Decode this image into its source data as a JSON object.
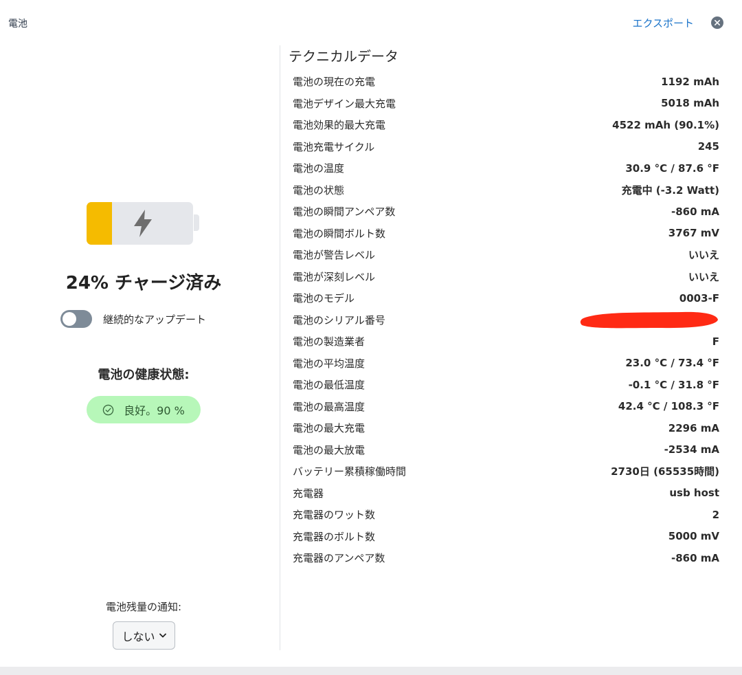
{
  "window": {
    "title": "電池"
  },
  "header": {
    "export_label": "エクスポート"
  },
  "battery": {
    "charge_percent": 24,
    "charge_text": "24% チャージ済み",
    "fill_color": "#f5bb00"
  },
  "continuous_update": {
    "label": "継続的なアップデート",
    "enabled": false
  },
  "health": {
    "title": "電池の健康状態:",
    "badge_text": "良好。90 %"
  },
  "notification": {
    "label": "電池残量の通知:",
    "selected": "しない"
  },
  "technical": {
    "title": "テクニカルデータ",
    "rows": [
      {
        "label": "電池の現在の充電",
        "value": "1192 mAh"
      },
      {
        "label": "電池デザイン最大充電",
        "value": "5018 mAh"
      },
      {
        "label": "電池効果的最大充電",
        "value": "4522 mAh (90.1%)"
      },
      {
        "label": "電池充電サイクル",
        "value": "245"
      },
      {
        "label": "電池の温度",
        "value": "30.9 °C / 87.6 °F"
      },
      {
        "label": "電池の状態",
        "value": "充電中 (-3.2 Watt)"
      },
      {
        "label": "電池の瞬間アンペア数",
        "value": "-860 mA"
      },
      {
        "label": "電池の瞬間ボルト数",
        "value": "3767 mV"
      },
      {
        "label": "電池が警告レベル",
        "value": "いいえ"
      },
      {
        "label": "電池が深刻レベル",
        "value": "いいえ"
      },
      {
        "label": "電池のモデル",
        "value": "0003-F"
      },
      {
        "label": "電池のシリアル番号",
        "value": ""
      },
      {
        "label": "電池の製造業者",
        "value": "F"
      },
      {
        "label": "電池の平均温度",
        "value": "23.0 °C / 73.4 °F"
      },
      {
        "label": "電池の最低温度",
        "value": "-0.1 °C / 31.8 °F"
      },
      {
        "label": "電池の最高温度",
        "value": "42.4 °C / 108.3 °F"
      },
      {
        "label": "電池の最大充電",
        "value": "2296 mA"
      },
      {
        "label": "電池の最大放電",
        "value": "-2534 mA"
      },
      {
        "label": "バッテリー累積稼働時間",
        "value": "2730日 (65535時間)"
      },
      {
        "label": "充電器",
        "value": "usb host"
      },
      {
        "label": "充電器のワット数",
        "value": "2"
      },
      {
        "label": "充電器のボルト数",
        "value": "5000 mV"
      },
      {
        "label": "充電器のアンペア数",
        "value": "-860 mA"
      }
    ]
  }
}
